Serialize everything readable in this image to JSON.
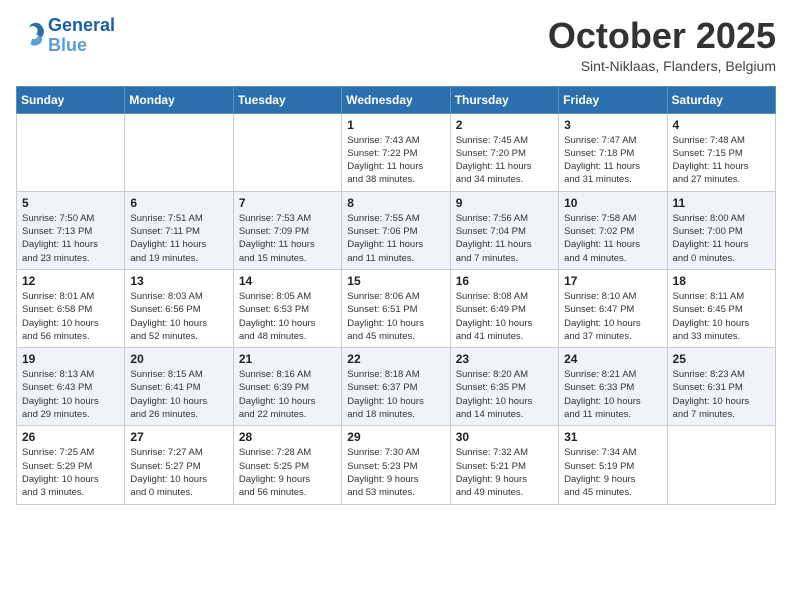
{
  "header": {
    "logo_line1": "General",
    "logo_line2": "Blue",
    "month": "October 2025",
    "location": "Sint-Niklaas, Flanders, Belgium"
  },
  "weekdays": [
    "Sunday",
    "Monday",
    "Tuesday",
    "Wednesday",
    "Thursday",
    "Friday",
    "Saturday"
  ],
  "weeks": [
    [
      {
        "day": "",
        "info": ""
      },
      {
        "day": "",
        "info": ""
      },
      {
        "day": "",
        "info": ""
      },
      {
        "day": "1",
        "info": "Sunrise: 7:43 AM\nSunset: 7:22 PM\nDaylight: 11 hours\nand 38 minutes."
      },
      {
        "day": "2",
        "info": "Sunrise: 7:45 AM\nSunset: 7:20 PM\nDaylight: 11 hours\nand 34 minutes."
      },
      {
        "day": "3",
        "info": "Sunrise: 7:47 AM\nSunset: 7:18 PM\nDaylight: 11 hours\nand 31 minutes."
      },
      {
        "day": "4",
        "info": "Sunrise: 7:48 AM\nSunset: 7:15 PM\nDaylight: 11 hours\nand 27 minutes."
      }
    ],
    [
      {
        "day": "5",
        "info": "Sunrise: 7:50 AM\nSunset: 7:13 PM\nDaylight: 11 hours\nand 23 minutes."
      },
      {
        "day": "6",
        "info": "Sunrise: 7:51 AM\nSunset: 7:11 PM\nDaylight: 11 hours\nand 19 minutes."
      },
      {
        "day": "7",
        "info": "Sunrise: 7:53 AM\nSunset: 7:09 PM\nDaylight: 11 hours\nand 15 minutes."
      },
      {
        "day": "8",
        "info": "Sunrise: 7:55 AM\nSunset: 7:06 PM\nDaylight: 11 hours\nand 11 minutes."
      },
      {
        "day": "9",
        "info": "Sunrise: 7:56 AM\nSunset: 7:04 PM\nDaylight: 11 hours\nand 7 minutes."
      },
      {
        "day": "10",
        "info": "Sunrise: 7:58 AM\nSunset: 7:02 PM\nDaylight: 11 hours\nand 4 minutes."
      },
      {
        "day": "11",
        "info": "Sunrise: 8:00 AM\nSunset: 7:00 PM\nDaylight: 11 hours\nand 0 minutes."
      }
    ],
    [
      {
        "day": "12",
        "info": "Sunrise: 8:01 AM\nSunset: 6:58 PM\nDaylight: 10 hours\nand 56 minutes."
      },
      {
        "day": "13",
        "info": "Sunrise: 8:03 AM\nSunset: 6:56 PM\nDaylight: 10 hours\nand 52 minutes."
      },
      {
        "day": "14",
        "info": "Sunrise: 8:05 AM\nSunset: 6:53 PM\nDaylight: 10 hours\nand 48 minutes."
      },
      {
        "day": "15",
        "info": "Sunrise: 8:06 AM\nSunset: 6:51 PM\nDaylight: 10 hours\nand 45 minutes."
      },
      {
        "day": "16",
        "info": "Sunrise: 8:08 AM\nSunset: 6:49 PM\nDaylight: 10 hours\nand 41 minutes."
      },
      {
        "day": "17",
        "info": "Sunrise: 8:10 AM\nSunset: 6:47 PM\nDaylight: 10 hours\nand 37 minutes."
      },
      {
        "day": "18",
        "info": "Sunrise: 8:11 AM\nSunset: 6:45 PM\nDaylight: 10 hours\nand 33 minutes."
      }
    ],
    [
      {
        "day": "19",
        "info": "Sunrise: 8:13 AM\nSunset: 6:43 PM\nDaylight: 10 hours\nand 29 minutes."
      },
      {
        "day": "20",
        "info": "Sunrise: 8:15 AM\nSunset: 6:41 PM\nDaylight: 10 hours\nand 26 minutes."
      },
      {
        "day": "21",
        "info": "Sunrise: 8:16 AM\nSunset: 6:39 PM\nDaylight: 10 hours\nand 22 minutes."
      },
      {
        "day": "22",
        "info": "Sunrise: 8:18 AM\nSunset: 6:37 PM\nDaylight: 10 hours\nand 18 minutes."
      },
      {
        "day": "23",
        "info": "Sunrise: 8:20 AM\nSunset: 6:35 PM\nDaylight: 10 hours\nand 14 minutes."
      },
      {
        "day": "24",
        "info": "Sunrise: 8:21 AM\nSunset: 6:33 PM\nDaylight: 10 hours\nand 11 minutes."
      },
      {
        "day": "25",
        "info": "Sunrise: 8:23 AM\nSunset: 6:31 PM\nDaylight: 10 hours\nand 7 minutes."
      }
    ],
    [
      {
        "day": "26",
        "info": "Sunrise: 7:25 AM\nSunset: 5:29 PM\nDaylight: 10 hours\nand 3 minutes."
      },
      {
        "day": "27",
        "info": "Sunrise: 7:27 AM\nSunset: 5:27 PM\nDaylight: 10 hours\nand 0 minutes."
      },
      {
        "day": "28",
        "info": "Sunrise: 7:28 AM\nSunset: 5:25 PM\nDaylight: 9 hours\nand 56 minutes."
      },
      {
        "day": "29",
        "info": "Sunrise: 7:30 AM\nSunset: 5:23 PM\nDaylight: 9 hours\nand 53 minutes."
      },
      {
        "day": "30",
        "info": "Sunrise: 7:32 AM\nSunset: 5:21 PM\nDaylight: 9 hours\nand 49 minutes."
      },
      {
        "day": "31",
        "info": "Sunrise: 7:34 AM\nSunset: 5:19 PM\nDaylight: 9 hours\nand 45 minutes."
      },
      {
        "day": "",
        "info": ""
      }
    ]
  ]
}
